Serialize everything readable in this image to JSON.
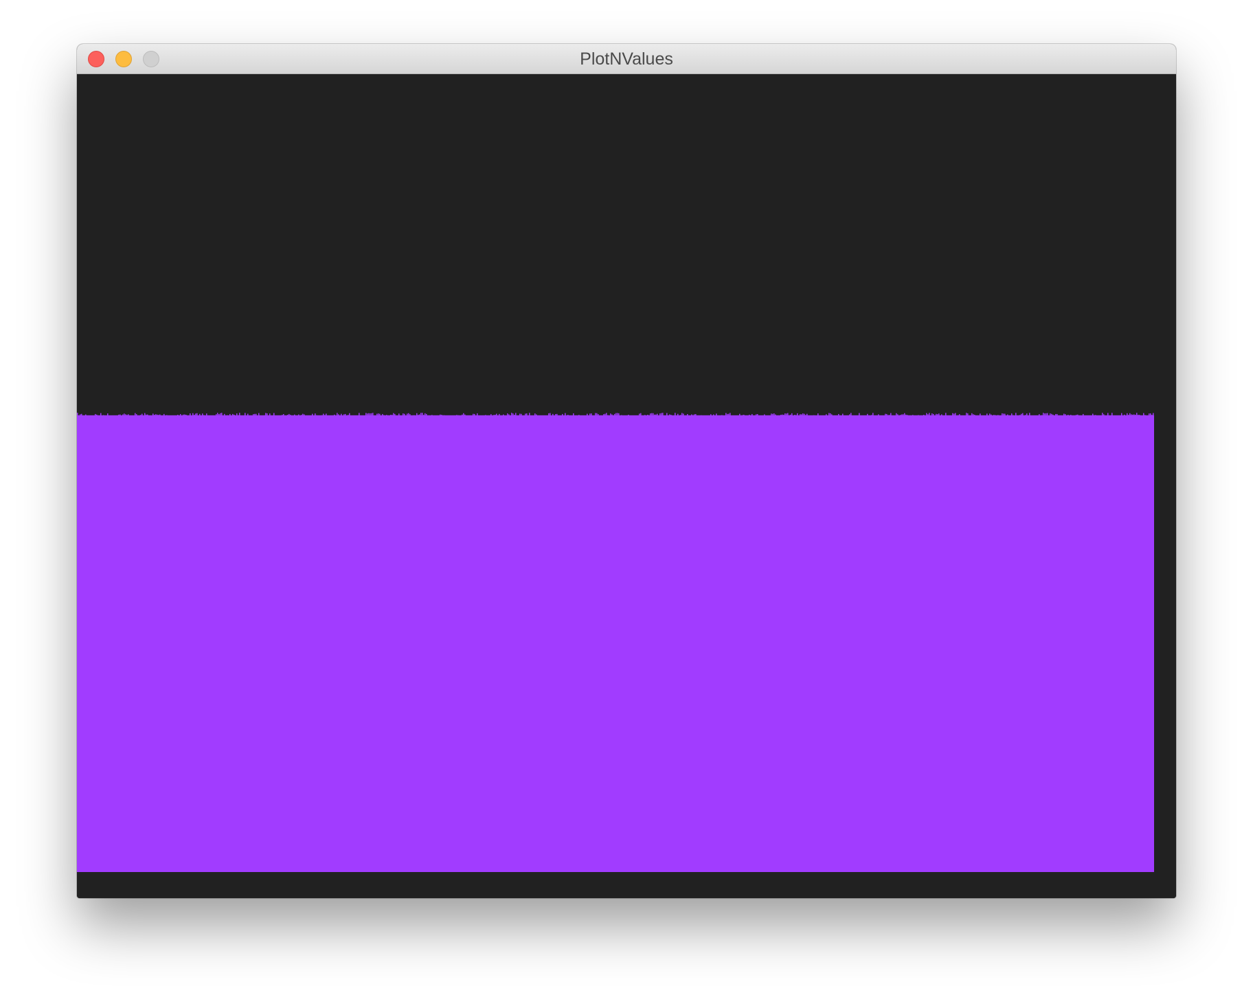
{
  "window": {
    "title": "PlotNValues",
    "controls": {
      "close": "close-icon",
      "minimize": "minimize-icon",
      "zoom": "zoom-icon"
    }
  },
  "plot": {
    "background_color": "#212121",
    "bar_color": "#a13cff",
    "approx_level_fraction": 0.586,
    "level_jitter_fraction": 0.003,
    "bar_count": 1568
  }
}
